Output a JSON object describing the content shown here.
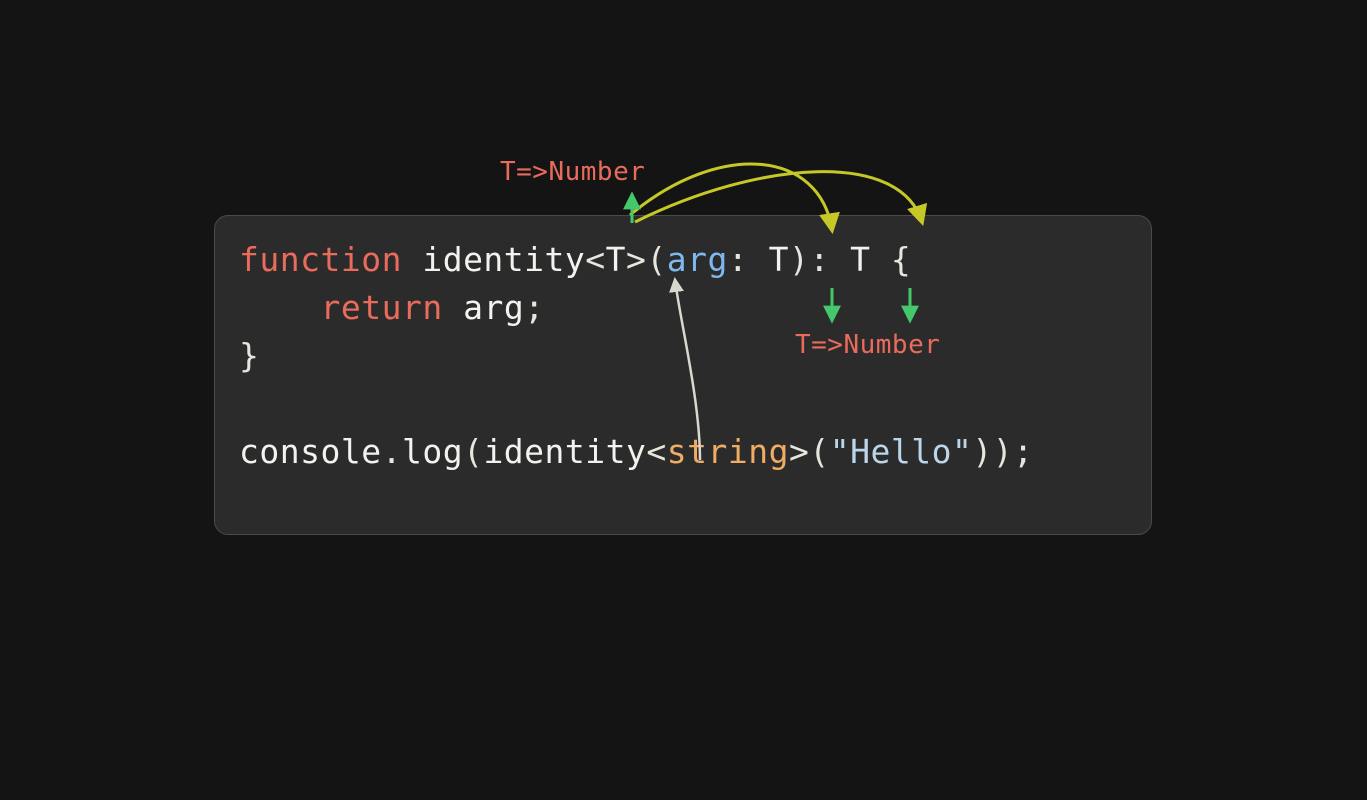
{
  "code": {
    "line1": {
      "kw_function": "function",
      "space1": " ",
      "fn_name": "identity",
      "lt": "<",
      "generic_T": "T",
      "gt": ">",
      "lparen": "(",
      "param_name": "arg",
      "colon_sp": ": ",
      "param_type_T": "T",
      "rparen_colon_sp": "): ",
      "ret_T": "T",
      "sp_brace": " {"
    },
    "line2": {
      "indent": "    ",
      "kw_return": "return",
      "space": " ",
      "ident_arg": "arg",
      "semi": ";"
    },
    "line3": {
      "rbrace": "}"
    },
    "line4_blank": "",
    "line5": {
      "console": "console",
      "dot": ".",
      "log": "log",
      "lparen": "(",
      "identity": "identity",
      "lt": "<",
      "string_type": "string",
      "gt": ">",
      "lparen2": "(",
      "str_hello": "\"Hello\"",
      "rparen2": ")",
      "rparen": ")",
      "semi": ";"
    }
  },
  "annotations": {
    "top_label": "T=>Number",
    "bottom_label": "T=>Number"
  },
  "colors": {
    "keyword": "#e86b5c",
    "param": "#7fb8ef",
    "type": "#efac62",
    "string": "#bcd5e8",
    "default": "#f2f2ee",
    "card_bg": "#2b2b2b",
    "page_bg": "#141414",
    "arrow_yellow": "#c5c827",
    "arrow_green": "#45c86b",
    "arrow_white": "#d8d8d0"
  }
}
